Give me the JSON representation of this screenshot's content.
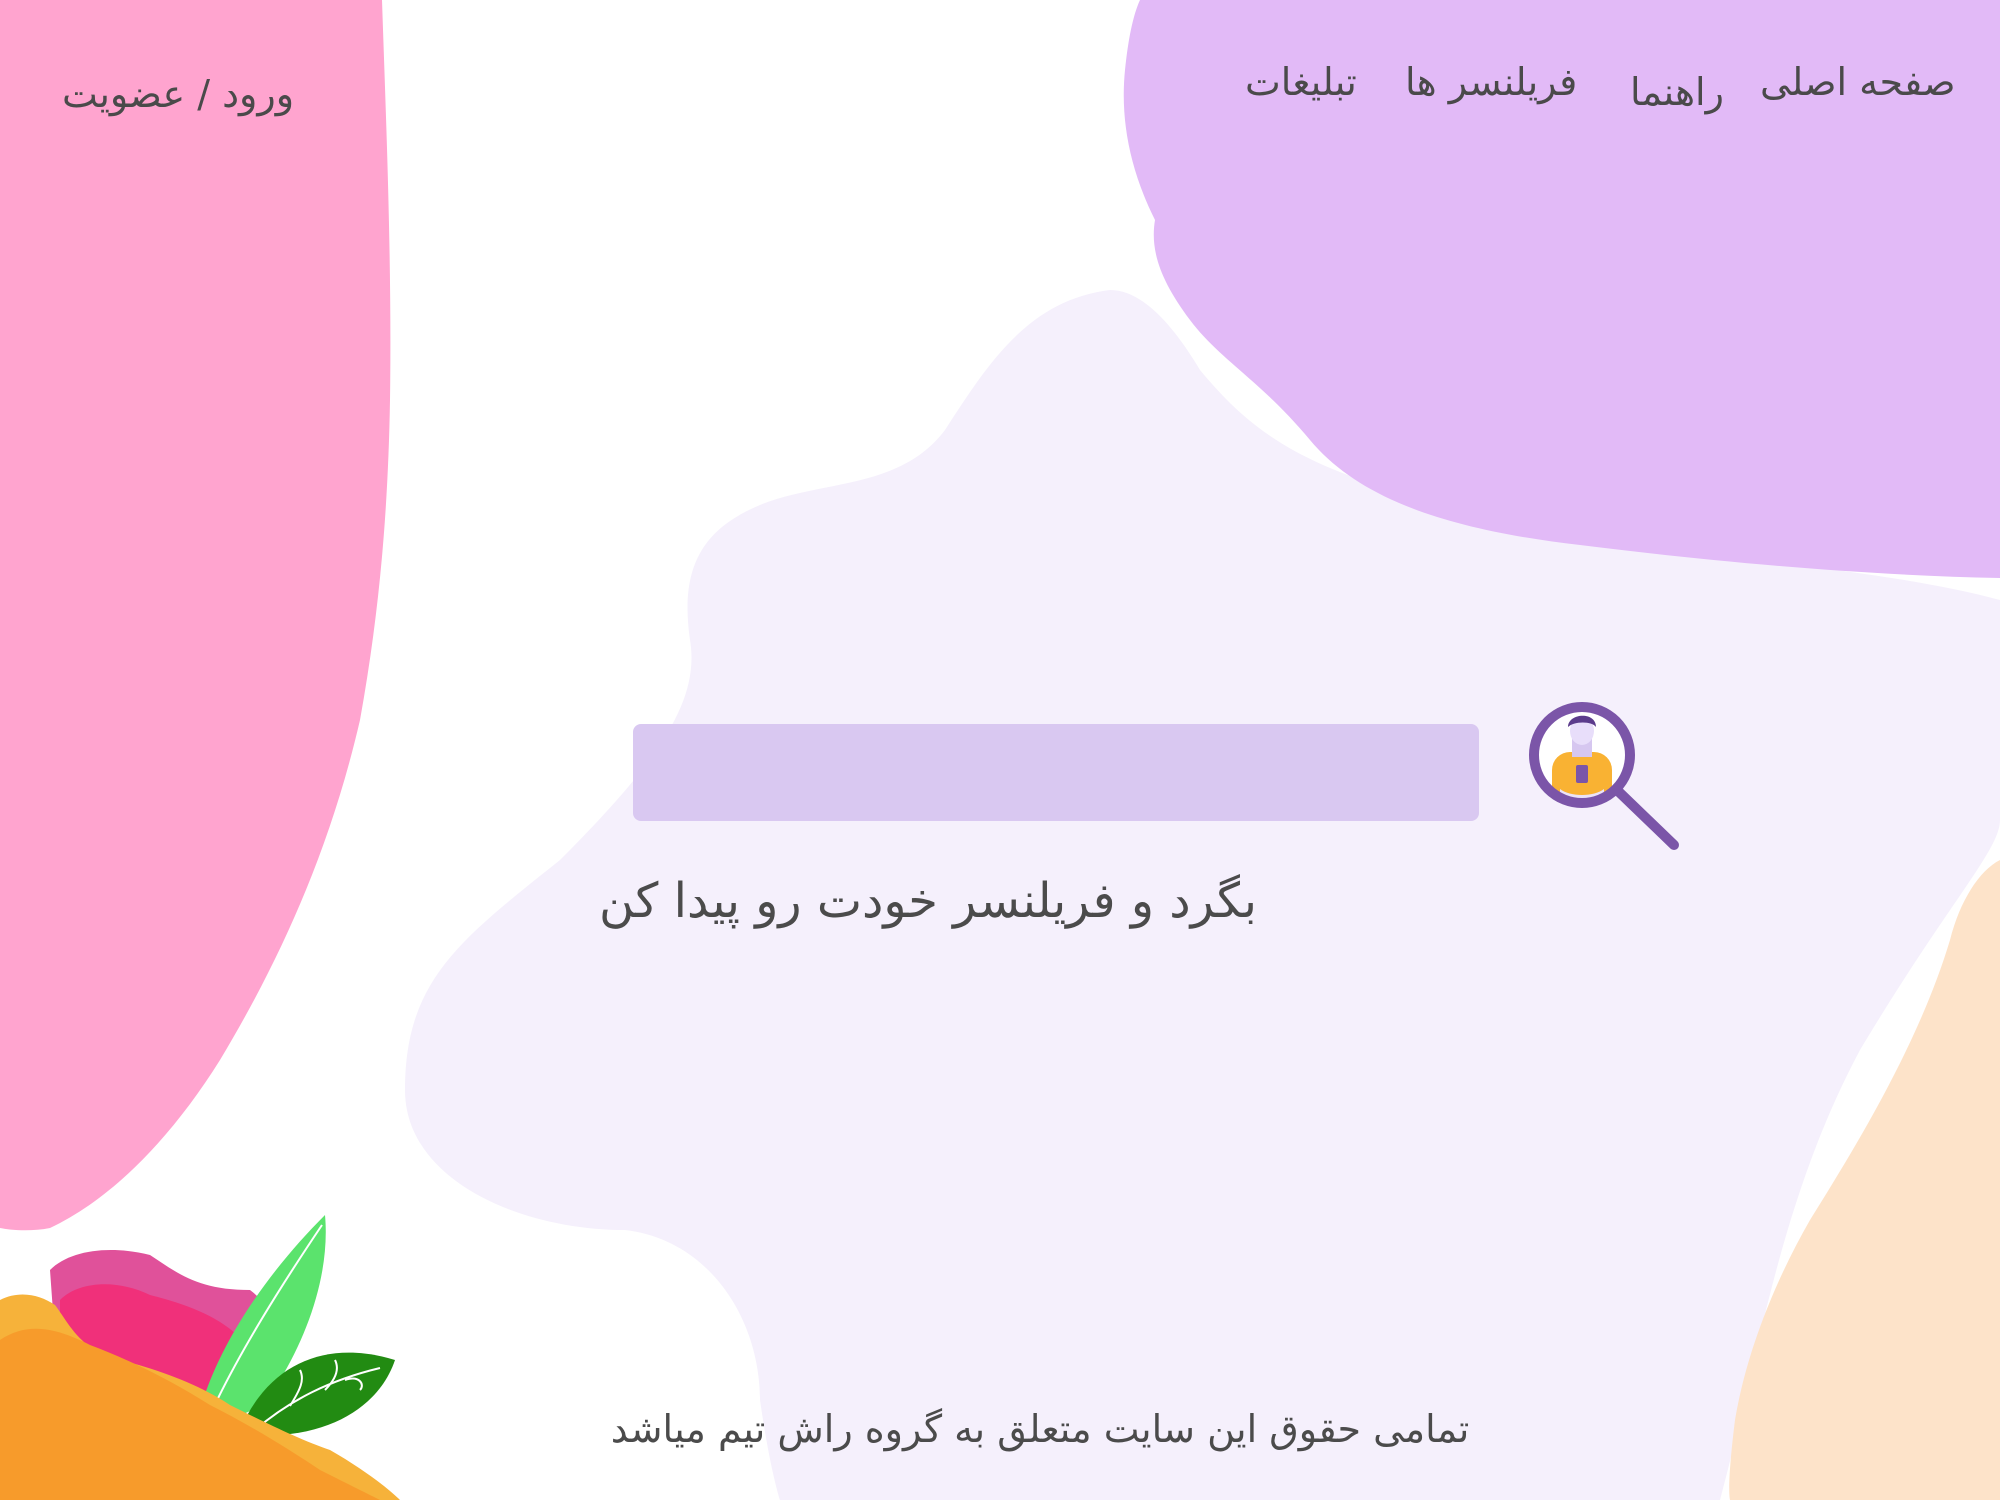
{
  "nav": {
    "items": [
      {
        "label": "صفحه اصلی"
      },
      {
        "label": "راهنما"
      },
      {
        "label": "فریلنسر ها"
      },
      {
        "label": "تبلیغات"
      }
    ],
    "login_label": "ورود / عضویت"
  },
  "search": {
    "placeholder": "",
    "value": "",
    "icon": "freelancer-search-icon"
  },
  "hero": {
    "tagline": "بگرد و فریلنسر خودت رو پیدا کن"
  },
  "footer": {
    "copyright": "تمامی حقوق این سایت متعلق به گروه راش تیم میاشد"
  },
  "colors": {
    "pink_blob": "#ffa4cf",
    "purple_blob": "#e2baf7",
    "lavender_blob": "#f5f0fc",
    "peach_blob": "#fde3c9",
    "search_bg": "#d9c8f1",
    "magnifier": "#7b55a8",
    "text": "#4b4b4b"
  }
}
